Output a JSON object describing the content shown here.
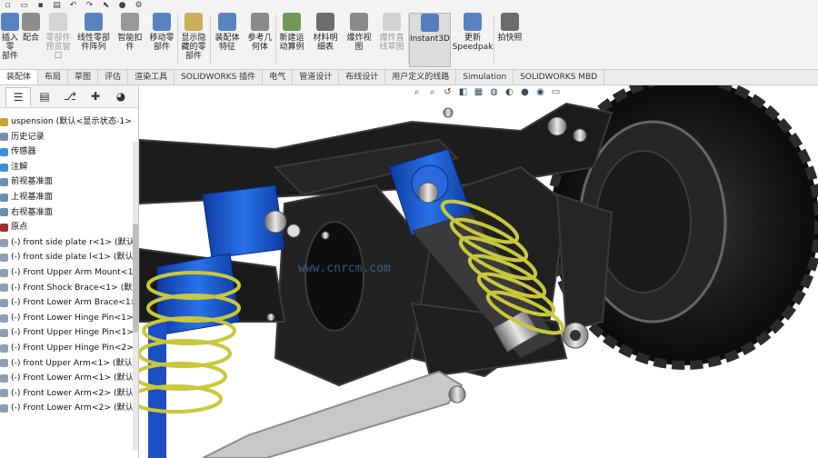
{
  "ribbon": {
    "buttons": [
      {
        "label": "插入零\n部件",
        "icon": "insert-component-icon",
        "color": "#3d6fb6"
      },
      {
        "label": "配合",
        "icon": "mate-icon",
        "color": "#7a7a7a"
      },
      {
        "label": "零部件\n预览窗\n口",
        "icon": "component-preview-icon",
        "color": "#b0b0b0",
        "disabled": true
      },
      {
        "label": "线性零部\n件阵列",
        "icon": "linear-pattern-icon",
        "color": "#3d6fb6"
      },
      {
        "label": "智能扣\n件",
        "icon": "smart-fastener-icon",
        "color": "#888"
      },
      {
        "label": "移动零\n部件",
        "icon": "move-component-icon",
        "color": "#3d6fb6"
      },
      {
        "label": "显示隐\n藏的零\n部件",
        "icon": "show-hidden-icon",
        "color": "#c4a23a"
      },
      {
        "label": "装配体\n特征",
        "icon": "assembly-feature-icon",
        "color": "#3d6fb6"
      },
      {
        "label": "参考几\n何体",
        "icon": "reference-geometry-icon",
        "color": "#777"
      },
      {
        "label": "新建运\n动算例",
        "icon": "motion-study-icon",
        "color": "#5a8a3a"
      },
      {
        "label": "材料明\n细表",
        "icon": "bom-icon",
        "color": "#555"
      },
      {
        "label": "爆炸视\n图",
        "icon": "exploded-view-icon",
        "color": "#777"
      },
      {
        "label": "爆炸直\n线草图",
        "icon": "explode-line-icon",
        "color": "#aaa",
        "disabled": true
      },
      {
        "label": "Instant3D",
        "icon": "instant3d-icon",
        "color": "#3d6fb6",
        "active": true
      },
      {
        "label": "更新\nSpeedpak",
        "icon": "speedpak-icon",
        "color": "#3d6fb6"
      },
      {
        "label": "拍快照",
        "icon": "snapshot-icon",
        "color": "#555"
      }
    ]
  },
  "tabs": [
    "装配体",
    "布局",
    "草图",
    "评估",
    "渲染工具",
    "SOLIDWORKS 插件",
    "电气",
    "管道设计",
    "布线设计",
    "用户定义的线路",
    "Simulation",
    "SOLIDWORKS MBD"
  ],
  "panel_tabs": [
    "feature-tree-icon",
    "property-manager-icon",
    "config-manager-icon",
    "dimxpert-icon",
    "display-manager-icon"
  ],
  "tree": [
    {
      "text": "uspension  (默认<显示状态-1>)",
      "color": "#c9a23a"
    },
    {
      "text": "历史记录",
      "color": "#7a8fa8"
    },
    {
      "text": "传感器",
      "color": "#3a8fd6"
    },
    {
      "text": "注解",
      "color": "#3a8fd6"
    },
    {
      "text": "前视基准面",
      "color": "#6a8fb0"
    },
    {
      "text": "上视基准面",
      "color": "#6a8fb0"
    },
    {
      "text": "右视基准面",
      "color": "#6a8fb0"
    },
    {
      "text": "原点",
      "color": "#a03030"
    },
    {
      "text": "(-) front side plate r<1> (默认",
      "color": "#8f9fb0"
    },
    {
      "text": "(-) front side plate l<1> (默认<",
      "color": "#8f9fb0"
    },
    {
      "text": "(-) Front Upper Arm Mount<1",
      "color": "#8f9fb0"
    },
    {
      "text": "(-) Front Shock Brace<1> (默认",
      "color": "#8f9fb0"
    },
    {
      "text": "(-) Front Lower Arm Brace<1>",
      "color": "#8f9fb0"
    },
    {
      "text": "(-) Front Lower Hinge Pin<1>",
      "color": "#8f9fb0"
    },
    {
      "text": "(-) Front Upper Hinge Pin<1>",
      "color": "#8f9fb0"
    },
    {
      "text": "(-) Front Upper Hinge Pin<2>",
      "color": "#8f9fb0"
    },
    {
      "text": "(-) front Upper Arm<1> (默认",
      "color": "#8f9fb0"
    },
    {
      "text": "(-) Front Lower Arm<1> (默认",
      "color": "#8f9fb0"
    },
    {
      "text": "(-) Front Lower Arm<2> (默认",
      "color": "#8f9fb0"
    },
    {
      "text": "(-) Front Lower Arm<2> (默认",
      "color": "#8f9fb0"
    }
  ],
  "viewport": {
    "hud_icons": [
      "zoom-to-fit-icon",
      "zoom-area-icon",
      "previous-view-icon",
      "section-view-icon",
      "view-orientation-icon",
      "display-style-icon",
      "hide-show-icon",
      "appearance-icon",
      "scene-icon",
      "view-settings-icon"
    ],
    "watermark": "www.cnrcm.com",
    "colors": {
      "spring": "#c8c83c",
      "shock": "#1f5fd0",
      "frame": "#1c1c1c",
      "tire": "#151515",
      "rim": "#8a8a8a"
    }
  }
}
